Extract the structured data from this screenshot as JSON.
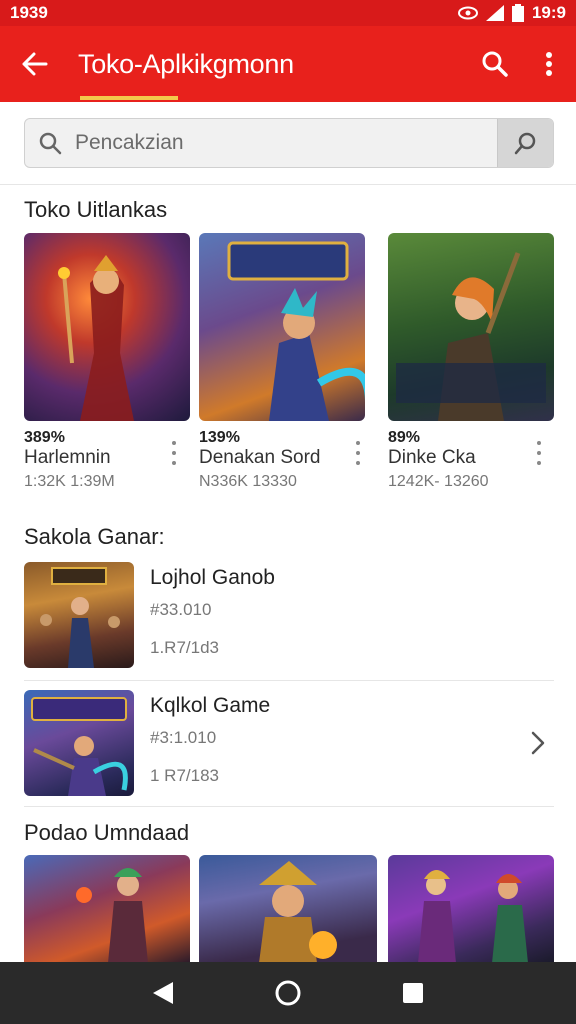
{
  "status_bar": {
    "time_left": "1939",
    "time_right": "19:9"
  },
  "app_bar": {
    "title": "Toko-Aplkikgmonn"
  },
  "search": {
    "placeholder": "Pencakzian"
  },
  "section1": {
    "title": "Toko Uitlankas",
    "cards": [
      {
        "percent": "389%",
        "name": "Harlemnin",
        "meta": "1:32K 1:39M"
      },
      {
        "percent": "139%",
        "name": "Denakan Sord",
        "meta": "N336K 13330"
      },
      {
        "percent": "89%",
        "name": "Dinke Cka",
        "meta": "1242K- 13260"
      }
    ]
  },
  "section2": {
    "title": "Sakola Ganar:",
    "items": [
      {
        "name": "Lojhol Ganob",
        "price": "#33.010",
        "sub": "1.R7/1d3"
      },
      {
        "name": "Kqlkol Game",
        "price": "#3:1.010",
        "sub": "1 R7/183"
      }
    ]
  },
  "section3": {
    "title": "Podao Umndaad"
  },
  "icons": {
    "back": "arrow-left-icon",
    "search": "search-icon",
    "menu": "more-vert-icon",
    "nav_back": "triangle-back-icon",
    "nav_home": "circle-home-icon",
    "nav_recent": "square-recent-icon"
  },
  "colors": {
    "app_bar": "#e8211c",
    "status_bar": "#d81a1a",
    "accent": "#f3c94b"
  }
}
